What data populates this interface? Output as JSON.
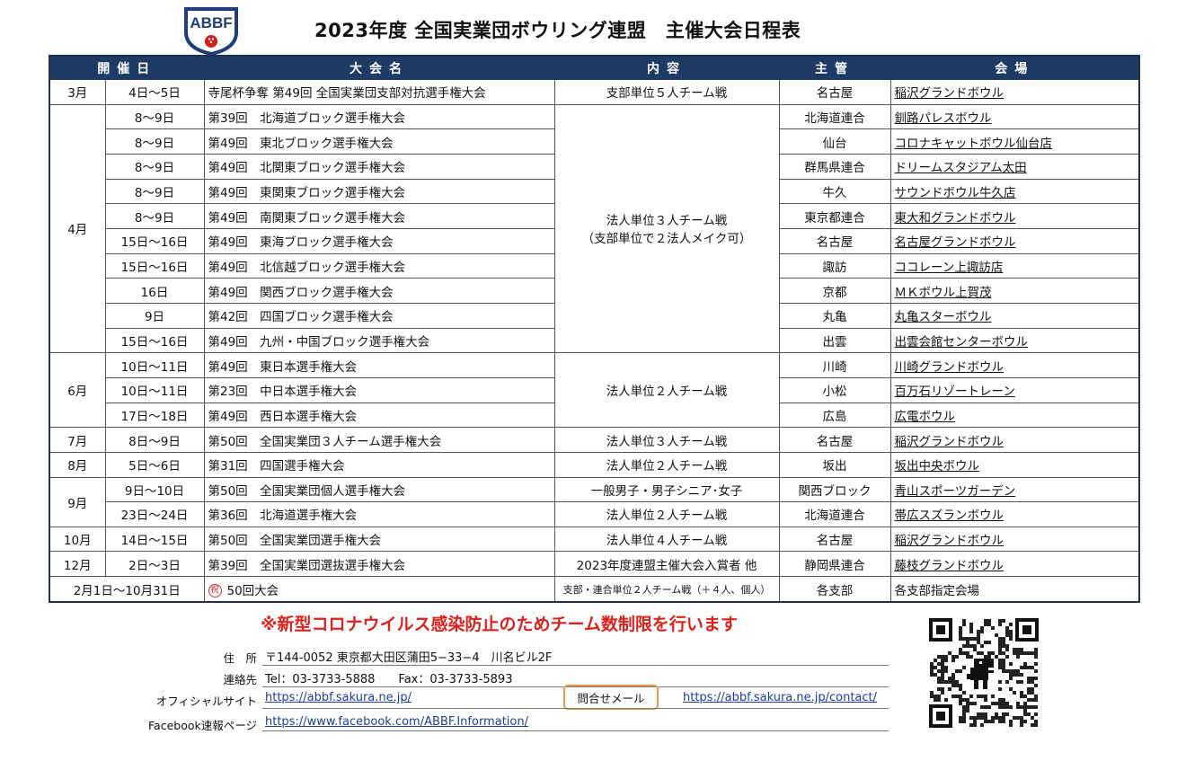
{
  "logo_text": "ABBF",
  "title": "2023年度 全国実業団ボウリング連盟　主催大会日程表",
  "headers": {
    "date": "開催日",
    "name": "大会名",
    "content": "内容",
    "host": "主管",
    "venue": "会場"
  },
  "months": {
    "mar": "3月",
    "apr": "4月",
    "jun": "6月",
    "jul": "7月",
    "aug": "8月",
    "sep": "9月",
    "oct": "10月",
    "dec": "12月"
  },
  "contents": {
    "c_mar": "支部単位５人チーム戦",
    "c_apr_1": "法人単位３人チーム戦",
    "c_apr_2": "（支部単位で２法人メイク可）",
    "c_jun": "法人単位２人チーム戦",
    "c_jul": "法人単位３人チーム戦",
    "c_aug": "法人単位２人チーム戦",
    "c_sep1": "一般男子・男子シニア･女子",
    "c_sep2": "法人単位２人チーム戦",
    "c_oct": "法人単位４人チーム戦",
    "c_dec": "2023年度連盟主催大会入賞者 他",
    "c_50th": "支部・連合単位２人チーム戦（＋４人、個人）"
  },
  "rows": [
    {
      "date": "4日～5日",
      "name": "寺尾杯争奪 第49回 全国実業団支部対抗選手権大会",
      "host": "名古屋",
      "venue": "稲沢グランドボウル"
    },
    {
      "date": "8～9日",
      "name": "第39回　北海道ブロック選手権大会",
      "host": "北海道連合",
      "venue": "釧路パレスボウル"
    },
    {
      "date": "8～9日",
      "name": "第49回　東北ブロック選手権大会",
      "host": "仙台",
      "venue": "コロナキャットボウル仙台店"
    },
    {
      "date": "8～9日",
      "name": "第49回　北関東ブロック選手権大会",
      "host": "群馬県連合",
      "venue": "ドリームスタジアム太田"
    },
    {
      "date": "8～9日",
      "name": "第49回　東関東ブロック選手権大会",
      "host": "牛久",
      "venue": "サウンドボウル牛久店"
    },
    {
      "date": "8～9日",
      "name": "第49回　南関東ブロック選手権大会",
      "host": "東京都連合",
      "venue": "東大和グランドボウル"
    },
    {
      "date": "15日～16日",
      "name": "第49回　東海ブロック選手権大会",
      "host": "名古屋",
      "venue": "名古屋グランドボウル"
    },
    {
      "date": "15日～16日",
      "name": "第49回　北信越ブロック選手権大会",
      "host": "諏訪",
      "venue": "ココレーン上諏訪店"
    },
    {
      "date": "16日",
      "name": "第49回　関西ブロック選手権大会",
      "host": "京都",
      "venue": "ＭＫボウル上賀茂"
    },
    {
      "date": "9日",
      "name": "第42回　四国ブロック選手権大会",
      "host": "丸亀",
      "venue": "丸亀スターボウル"
    },
    {
      "date": "15日～16日",
      "name": "第49回　九州・中国ブロック選手権大会",
      "host": "出雲",
      "venue": "出雲会館センターボウル"
    },
    {
      "date": "10日～11日",
      "name": "第49回　東日本選手権大会",
      "host": "川崎",
      "venue": "川崎グランドボウル"
    },
    {
      "date": "10日～11日",
      "name": "第23回　中日本選手権大会",
      "host": "小松",
      "venue": "百万石リゾートレーン"
    },
    {
      "date": "17日～18日",
      "name": "第49回　西日本選手権大会",
      "host": "広島",
      "venue": "広電ボウル"
    },
    {
      "date": "8日～9日",
      "name": "第50回　全国実業団３人チーム選手権大会",
      "host": "名古屋",
      "venue": "稲沢グランドボウル"
    },
    {
      "date": "5日～6日",
      "name": "第31回　四国選手権大会",
      "host": "坂出",
      "venue": "坂出中央ボウル"
    },
    {
      "date": "9日～10日",
      "name": "第50回　全国実業団個人選手権大会",
      "host": "関西ブロック",
      "venue": "青山スポーツガーデン"
    },
    {
      "date": "23日～24日",
      "name": "第36回　北海道選手権大会",
      "host": "北海道連合",
      "venue": "帯広スズランボウル"
    },
    {
      "date": "14日～15日",
      "name": "第50回　全国実業団選手権大会",
      "host": "名古屋",
      "venue": "稲沢グランドボウル"
    },
    {
      "date": "2日～3日",
      "name": "第39回　全国実業団選抜選手権大会",
      "host": "静岡県連合",
      "venue": "藤枝グランドボウル"
    },
    {
      "date": "2月1日～10月31日",
      "stamp": "祝",
      "name": "50回大会",
      "host": "各支部",
      "venue": "各支部指定会場"
    }
  ],
  "notice": "※新型コロナウイルス感染防止のためチーム数制限を行います",
  "contact": {
    "address_label": "住　所",
    "address": "〒144-0052 東京都大田区蒲田5−33−4　川名ビル2F",
    "phone_label": "連絡先",
    "phone": "Tel：03-3733-5888　　Fax：03-3733-5893",
    "site_label": "オフィシャルサイト",
    "site_url": "https://abbf.sakura.ne.jp/",
    "mail_label": "問合せメール",
    "contact_url": "https://abbf.sakura.ne.jp/contact/",
    "facebook_label": "Facebook速報ページ",
    "facebook_url": "https://www.facebook.com/ABBF.Information/"
  },
  "colors": {
    "header_bg": "#1e3b66",
    "notice": "#e0201c",
    "mail_border": "#e69a4a",
    "link": "#1a3fa0"
  },
  "qr_icon": "qr-code-with-dinosaur-icon"
}
